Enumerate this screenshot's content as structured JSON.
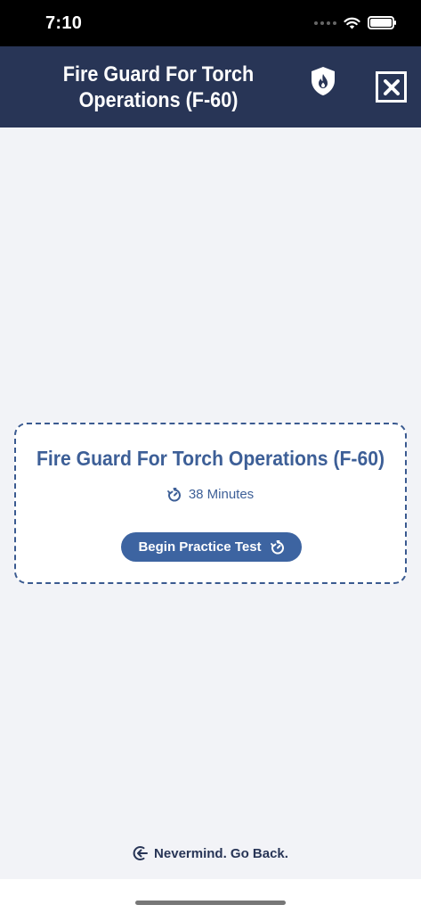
{
  "status_bar": {
    "time": "7:10"
  },
  "header": {
    "title": "Fire Guard For Torch Operations (F-60)",
    "shield_icon": "fire-shield-icon",
    "close_icon": "close-square-icon"
  },
  "card": {
    "title": "Fire Guard For Torch Operations (F-60)",
    "duration": "38 Minutes",
    "timer_icon": "timer-icon",
    "begin_label": "Begin Practice Test"
  },
  "footer": {
    "go_back_label": "Nevermind. Go Back.",
    "go_back_icon": "back-arrow-circle-icon"
  },
  "colors": {
    "header_bg": "#283556",
    "accent": "#3d5f97",
    "button_bg": "#3d64a1",
    "page_bg": "#f2f3f7"
  }
}
